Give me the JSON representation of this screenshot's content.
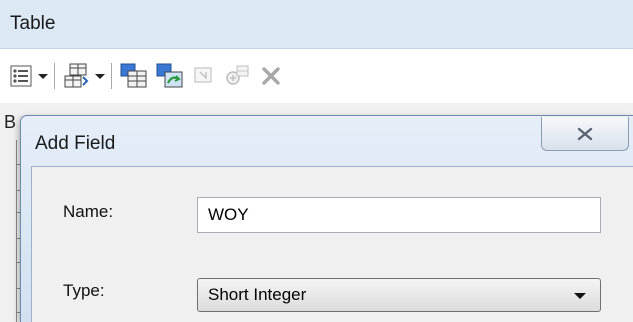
{
  "window": {
    "title": "Table",
    "behind_tab_label": "B"
  },
  "toolbar": {
    "items": [
      {
        "name": "table-options-icon",
        "has_dropdown": true
      },
      {
        "name": "related-tables-icon",
        "has_dropdown": true
      },
      {
        "name": "select-by-attributes-icon"
      },
      {
        "name": "switch-selection-icon"
      },
      {
        "name": "clear-selection-icon",
        "disabled": true
      },
      {
        "name": "zoom-to-selected-icon",
        "disabled": true
      },
      {
        "name": "delete-selected-icon",
        "disabled": true
      }
    ]
  },
  "dialog": {
    "title": "Add Field",
    "close_label": "✕",
    "name_label": "Name:",
    "name_value": "WOY",
    "type_label": "Type:",
    "type_value": "Short Integer"
  },
  "colors": {
    "titlebar": "#dde8f5",
    "dialog_frame": "#d3e0f0",
    "dialog_border": "#6d8aab",
    "client": "#f0f0f0"
  }
}
